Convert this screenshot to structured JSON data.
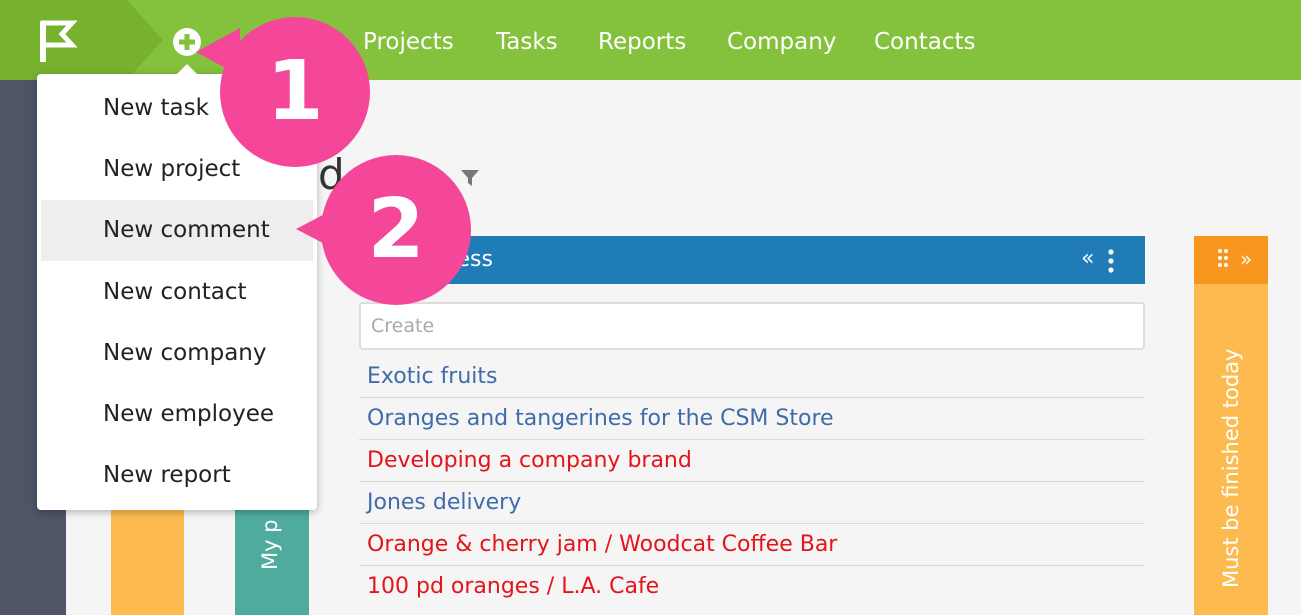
{
  "header": {
    "nav": [
      "Projects",
      "Tasks",
      "Reports",
      "Company",
      "Contacts"
    ],
    "logo_icon": "flag-icon",
    "add_icon": "plus-circle-icon"
  },
  "dropdown": {
    "items": [
      "New task",
      "New project",
      "New comment",
      "New contact",
      "New company",
      "New employee",
      "New report"
    ],
    "active": "New comment"
  },
  "callouts": [
    "1",
    "2"
  ],
  "board": {
    "title_fragment": "d",
    "filter_icon": "filter-icon",
    "left_column_label": "My p",
    "column": {
      "title": "gress",
      "create_placeholder": "Create",
      "tasks": [
        {
          "text": "Exotic fruits",
          "color": "#3f6ca8"
        },
        {
          "text": "Oranges and tangerines for the CSM Store",
          "color": "#3f6ca8"
        },
        {
          "text": "Developing a company brand",
          "color": "#e3141a"
        },
        {
          "text": "Jones delivery",
          "color": "#3f6ca8"
        },
        {
          "text": "Orange & cherry jam / Woodcat Coffee Bar",
          "color": "#e3141a"
        },
        {
          "text": "100 pd oranges / L.A. Cafe",
          "color": "#e3141a"
        }
      ]
    },
    "right_column_label": "Must be finished today"
  },
  "colors": {
    "topbar": "#84c13c",
    "column_header": "#1f7cb6",
    "callout": "#f5479a",
    "orange_column": "#fdbb4f",
    "teal_column": "#4fab9d"
  }
}
